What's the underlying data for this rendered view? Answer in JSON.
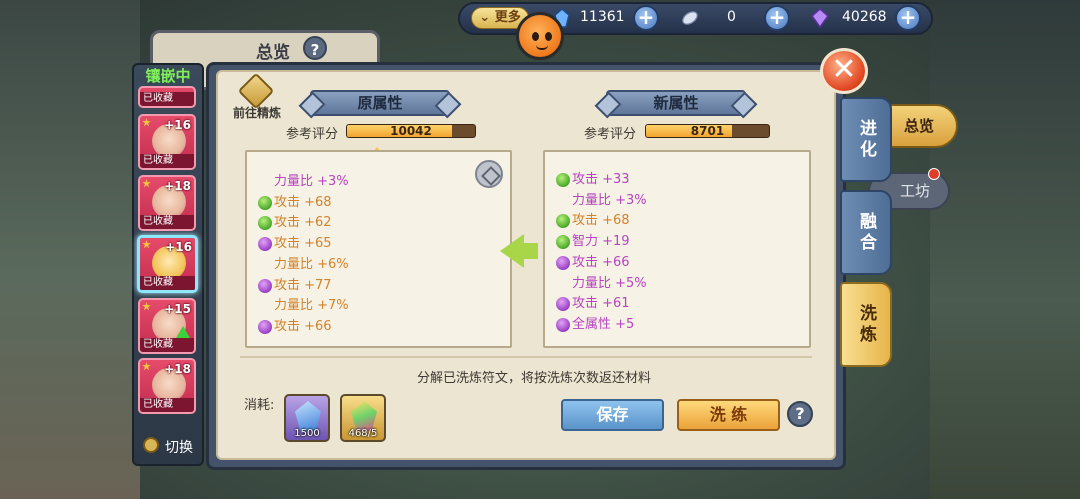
{
  "resources": {
    "more_label": "更多",
    "items": [
      {
        "icon": "blue-crystal-icon",
        "value": "11361"
      },
      {
        "icon": "feather-icon",
        "value": "0"
      },
      {
        "icon": "purple-gem-icon",
        "value": "40268"
      }
    ]
  },
  "background_tabs": {
    "overview_title": "总览",
    "help": "?",
    "overview_pill": "总览",
    "workshop_pill": "工坊"
  },
  "gem_list": {
    "title": "镶嵌中",
    "items": [
      {
        "level": "",
        "tag": "已收藏"
      },
      {
        "level": "+16",
        "tag": "已收藏"
      },
      {
        "level": "+18",
        "tag": "已收藏"
      },
      {
        "level": "+16",
        "tag": "已收藏",
        "selected": true
      },
      {
        "level": "+15",
        "tag": "已收藏",
        "upgrade": true
      },
      {
        "level": "+18",
        "tag": "已收藏"
      }
    ],
    "switch_label": "切换"
  },
  "panel": {
    "goto_label": "前往精炼",
    "old": {
      "title": "原属性",
      "score_label": "参考评分",
      "score": "10042",
      "score_fill": 0.82,
      "attrs": [
        {
          "text": "力量比 +3%",
          "dot": "none",
          "color": "#b844c0"
        },
        {
          "text": "攻击 +68",
          "dot": "green",
          "color": "#d2832a"
        },
        {
          "text": "攻击 +62",
          "dot": "green",
          "color": "#d2832a"
        },
        {
          "text": "攻击 +65",
          "dot": "purple",
          "color": "#d2832a"
        },
        {
          "text": "力量比 +6%",
          "dot": "none",
          "color": "#d2832a"
        },
        {
          "text": "攻击 +77",
          "dot": "purple",
          "color": "#d2832a"
        },
        {
          "text": "力量比 +7%",
          "dot": "none",
          "color": "#d2832a"
        },
        {
          "text": "攻击 +66",
          "dot": "purple",
          "color": "#d2832a"
        }
      ]
    },
    "new": {
      "title": "新属性",
      "score_label": "参考评分",
      "score": "8701",
      "score_fill": 0.7,
      "attrs": [
        {
          "text": "攻击 +33",
          "dot": "green",
          "color": "#b844c0"
        },
        {
          "text": "力量比 +3%",
          "dot": "none",
          "color": "#b844c0"
        },
        {
          "text": "攻击 +68",
          "dot": "green",
          "color": "#d2832a"
        },
        {
          "text": "智力 +19",
          "dot": "green",
          "color": "#b844c0"
        },
        {
          "text": "攻击 +66",
          "dot": "purple",
          "color": "#b844c0"
        },
        {
          "text": "力量比 +5%",
          "dot": "none",
          "color": "#b844c0"
        },
        {
          "text": "攻击 +61",
          "dot": "purple",
          "color": "#b844c0"
        },
        {
          "text": "全属性 +5",
          "dot": "purple",
          "color": "#b844c0"
        }
      ]
    },
    "info_text": "分解已洗炼符文，将按洗炼次数返还材料",
    "consume_label": "消耗:",
    "consume_items": [
      {
        "icon": "blue-crystal-icon",
        "count": "1500"
      },
      {
        "icon": "rainbow-gem-icon",
        "count": "468/5"
      }
    ],
    "save_label": "保存",
    "wash_label": "洗 练",
    "help": "?",
    "close": "✕"
  },
  "side_tabs": [
    {
      "label": "进化",
      "active": false
    },
    {
      "label": "融合",
      "active": false
    },
    {
      "label": "洗炼",
      "active": true
    }
  ]
}
